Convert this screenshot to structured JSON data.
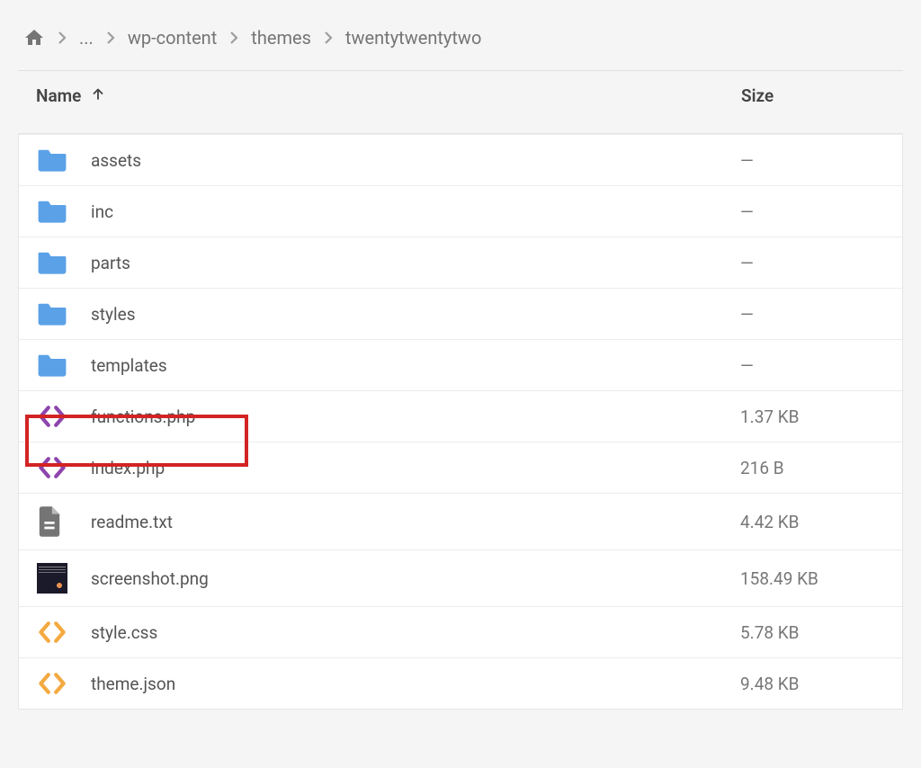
{
  "breadcrumb": {
    "ellipsis": "...",
    "items": [
      "wp-content",
      "themes",
      "twentytwentytwo"
    ]
  },
  "columns": {
    "name": "Name",
    "size": "Size"
  },
  "files": [
    {
      "icon": "folder",
      "name": "assets",
      "size": "—"
    },
    {
      "icon": "folder",
      "name": "inc",
      "size": "—"
    },
    {
      "icon": "folder",
      "name": "parts",
      "size": "—"
    },
    {
      "icon": "folder",
      "name": "styles",
      "size": "—"
    },
    {
      "icon": "folder",
      "name": "templates",
      "size": "—"
    },
    {
      "icon": "code-p",
      "name": "functions.php",
      "size": "1.37 KB"
    },
    {
      "icon": "code-p",
      "name": "index.php",
      "size": "216 B"
    },
    {
      "icon": "doc",
      "name": "readme.txt",
      "size": "4.42 KB"
    },
    {
      "icon": "thumb",
      "name": "screenshot.png",
      "size": "158.49 KB"
    },
    {
      "icon": "code-o",
      "name": "style.css",
      "size": "5.78 KB"
    },
    {
      "icon": "code-o",
      "name": "theme.json",
      "size": "9.48 KB"
    }
  ],
  "colors": {
    "folder": "#5aa1e8",
    "code_purple": "#8e44ad",
    "code_orange": "#f4a940",
    "doc_gray": "#757575"
  }
}
